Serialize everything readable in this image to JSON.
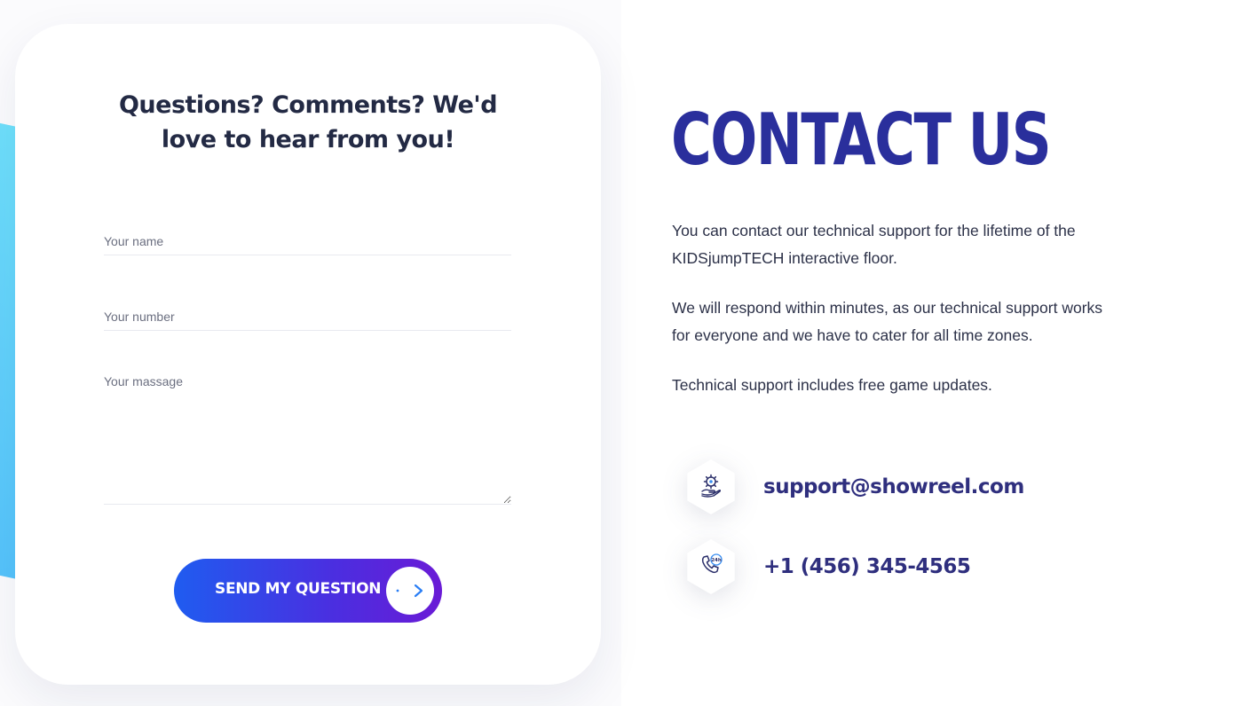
{
  "form": {
    "title": "Questions? Comments? We'd love to hear from you!",
    "name_placeholder": "Your name",
    "number_placeholder": "Your number",
    "message_placeholder": "Your massage",
    "send_label": "SEND MY QUESTION",
    "send_icon": "arrow-right-icon"
  },
  "contact": {
    "title": "CONTACT US",
    "paragraphs": [
      "You can contact our technical support for the lifetime of the KIDSjumpTECH interactive floor.",
      "We will respond within minutes, as our technical support works for everyone and we have to cater for all time zones.",
      "Technical support includes free game updates."
    ],
    "email": {
      "icon": "support-gear-hand-icon",
      "value": "support@showreel.com"
    },
    "phone": {
      "icon": "phone-24h-icon",
      "value": "+1 (456) 345-4565"
    }
  },
  "colors": {
    "title_blue": "#2a2f9c",
    "button_start": "#1f5cf0",
    "button_end": "#6a1bd6",
    "deco_cyan": "#6fe0fb",
    "contact_link": "#2f2f7e"
  }
}
